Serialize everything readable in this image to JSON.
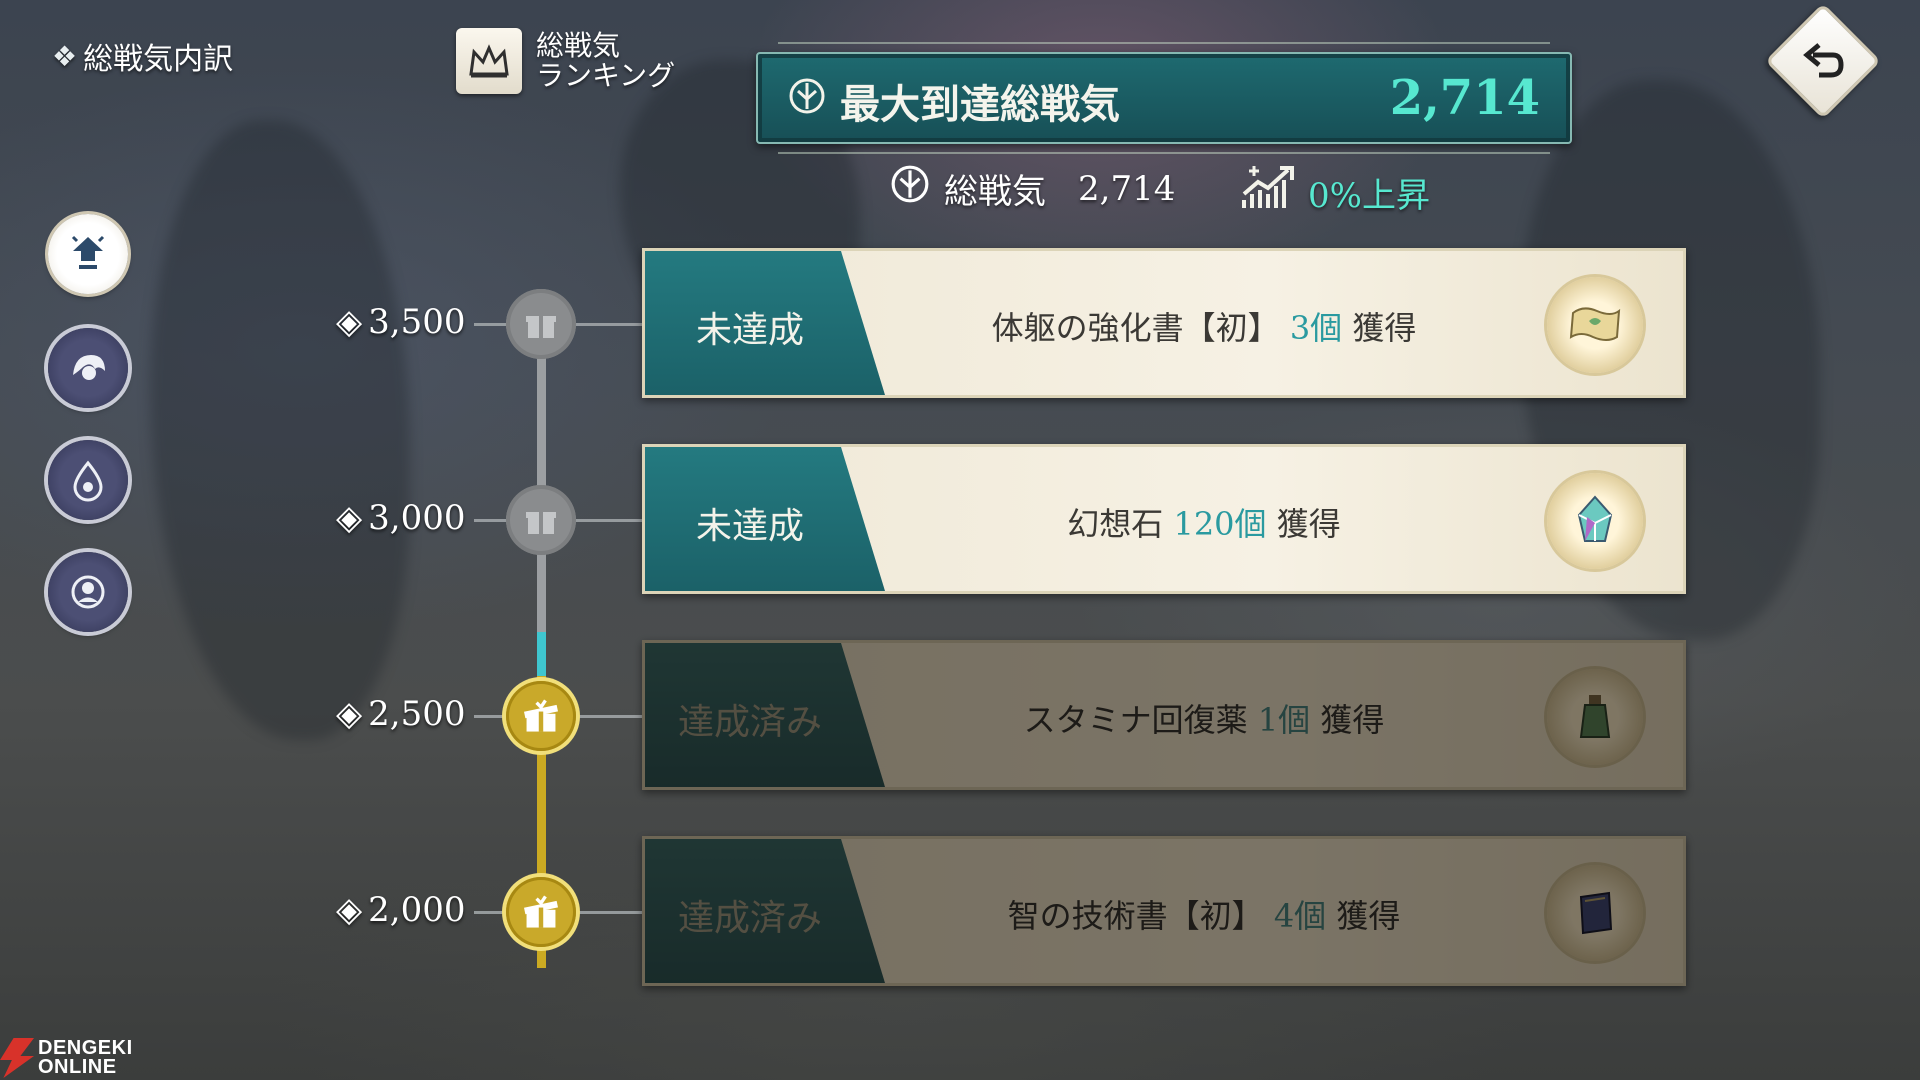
{
  "header": {
    "breakdown_label": "総戦気内訳",
    "ranking_line1": "総戦気",
    "ranking_line2": "ランキング"
  },
  "banner": {
    "label": "最大到達総戦気",
    "value": "2,714"
  },
  "summary": {
    "total_label": "総戦気",
    "total_value": "2,714",
    "rise_text": "0%上昇"
  },
  "colors": {
    "accent_teal": "#57e8d0",
    "card_teal": "#1e6a70",
    "node_gold": "#c9a92a"
  },
  "side_nav": [
    {
      "icon": "skill-up-icon",
      "active": true
    },
    {
      "icon": "character-icon",
      "active": false
    },
    {
      "icon": "element-drop-icon",
      "active": false
    },
    {
      "icon": "profile-icon",
      "active": false
    }
  ],
  "milestones": [
    {
      "threshold": "3,500",
      "status": "未達成",
      "reward_name": "体躯の強化書【初】",
      "reward_qty": "3個",
      "obtain": "獲得",
      "item_icon": "scroll-icon",
      "achieved": false
    },
    {
      "threshold": "3,000",
      "status": "未達成",
      "reward_name": "幻想石",
      "reward_qty": "120個",
      "obtain": "獲得",
      "item_icon": "crystal-icon",
      "achieved": false
    },
    {
      "threshold": "2,500",
      "status": "達成済み",
      "reward_name": "スタミナ回復薬",
      "reward_qty": "1個",
      "obtain": "獲得",
      "item_icon": "potion-icon",
      "achieved": true
    },
    {
      "threshold": "2,000",
      "status": "達成済み",
      "reward_name": "智の技術書【初】",
      "reward_qty": "4個",
      "obtain": "獲得",
      "item_icon": "book-icon",
      "achieved": true
    }
  ],
  "watermark": {
    "line1": "DENGEKI",
    "line2": "ONLINE"
  }
}
